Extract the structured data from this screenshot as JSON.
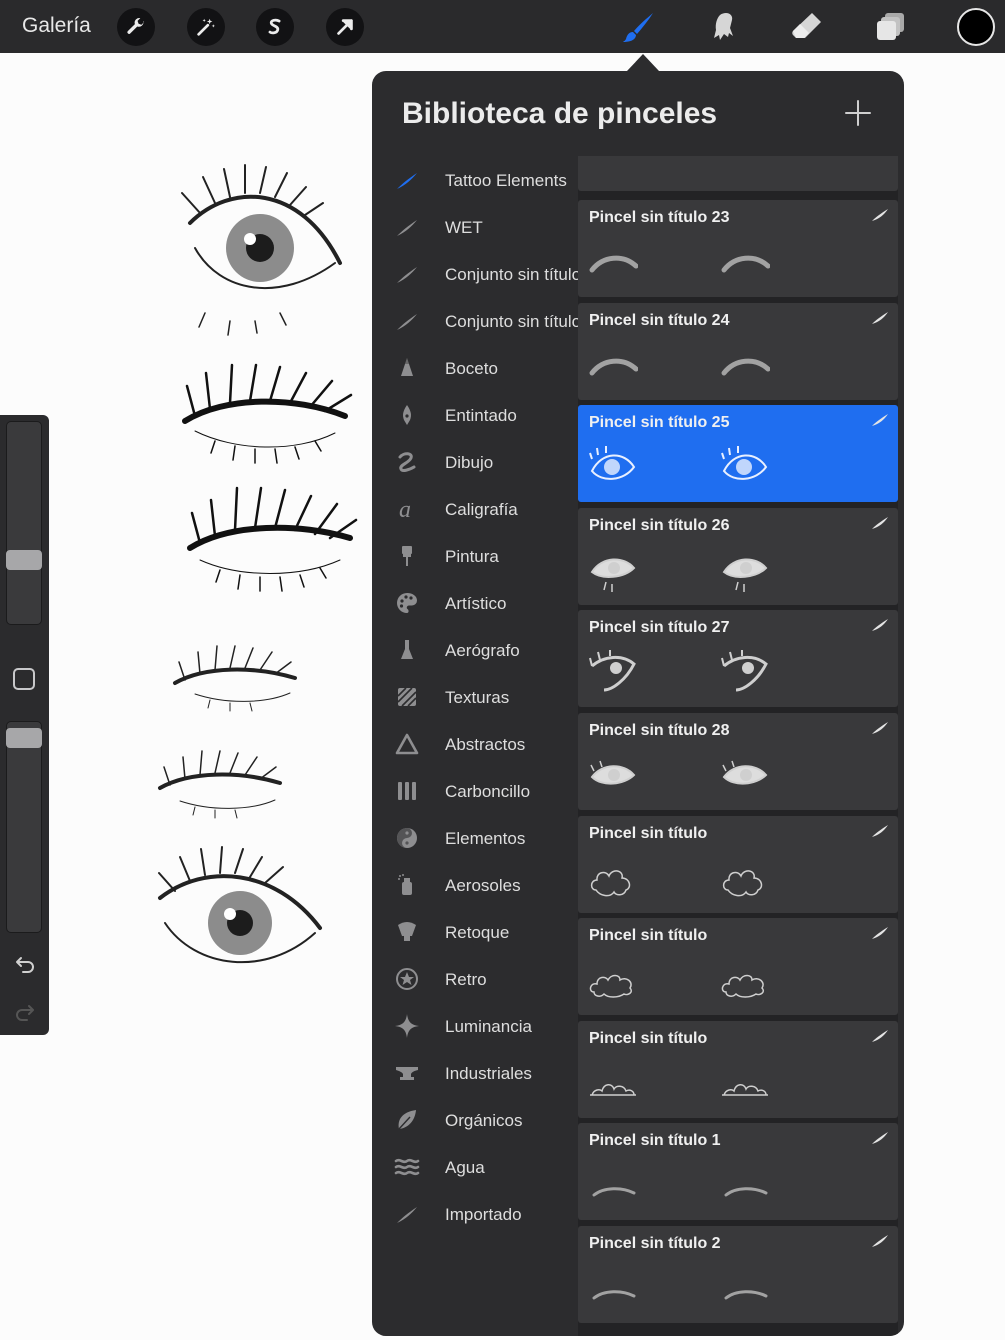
{
  "topbar": {
    "gallery_label": "Galería",
    "left_tools": [
      "wrench-icon",
      "magic-wand-icon",
      "selection-s-icon",
      "transform-arrow-icon"
    ],
    "right_tools": [
      "brush-icon",
      "smudge-icon",
      "eraser-icon",
      "layers-icon"
    ],
    "active_tool": "brush-icon",
    "active_color": "#1f6ef0",
    "current_color": "#000000"
  },
  "panel": {
    "title": "Biblioteca de pinceles",
    "categories": [
      {
        "label": "Tattoo Elements",
        "icon": "stroke-icon",
        "selected": true
      },
      {
        "label": "WET",
        "icon": "stroke-icon"
      },
      {
        "label": "Conjunto sin título",
        "icon": "stroke-icon"
      },
      {
        "label": "Conjunto sin título",
        "icon": "stroke-icon"
      },
      {
        "label": "Boceto",
        "icon": "pencil-tip-icon"
      },
      {
        "label": "Entintado",
        "icon": "ink-nib-icon"
      },
      {
        "label": "Dibujo",
        "icon": "squiggle-icon"
      },
      {
        "label": "Caligrafía",
        "icon": "calligraphy-a-icon"
      },
      {
        "label": "Pintura",
        "icon": "paint-brush-icon"
      },
      {
        "label": "Artístico",
        "icon": "palette-icon"
      },
      {
        "label": "Aerógrafo",
        "icon": "airbrush-icon"
      },
      {
        "label": "Texturas",
        "icon": "texture-icon"
      },
      {
        "label": "Abstractos",
        "icon": "triangle-icon"
      },
      {
        "label": "Carboncillo",
        "icon": "charcoal-icon"
      },
      {
        "label": "Elementos",
        "icon": "yin-yang-icon"
      },
      {
        "label": "Aerosoles",
        "icon": "spray-can-icon"
      },
      {
        "label": "Retoque",
        "icon": "retouch-icon"
      },
      {
        "label": "Retro",
        "icon": "star-circle-icon"
      },
      {
        "label": "Luminancia",
        "icon": "sparkle-icon"
      },
      {
        "label": "Industriales",
        "icon": "anvil-icon"
      },
      {
        "label": "Orgánicos",
        "icon": "leaf-icon"
      },
      {
        "label": "Agua",
        "icon": "waves-icon"
      },
      {
        "label": "Importado",
        "icon": "stroke-icon"
      }
    ],
    "brushes": [
      {
        "name": "Pincel sin título 23",
        "preview": "brow"
      },
      {
        "name": "Pincel sin título 24",
        "preview": "brow"
      },
      {
        "name": "Pincel sin título 25",
        "preview": "eye",
        "selected": true
      },
      {
        "name": "Pincel sin título 26",
        "preview": "eye-lash"
      },
      {
        "name": "Pincel sin título 27",
        "preview": "eye-side"
      },
      {
        "name": "Pincel sin título 28",
        "preview": "eye-small"
      },
      {
        "name": "Pincel sin título",
        "preview": "cloud"
      },
      {
        "name": "Pincel sin título",
        "preview": "cloud-wide"
      },
      {
        "name": "Pincel sin título",
        "preview": "cloud-flat"
      },
      {
        "name": "Pincel sin título 1",
        "preview": "brow-thin"
      },
      {
        "name": "Pincel sin título 2",
        "preview": "brow-thin"
      }
    ]
  }
}
